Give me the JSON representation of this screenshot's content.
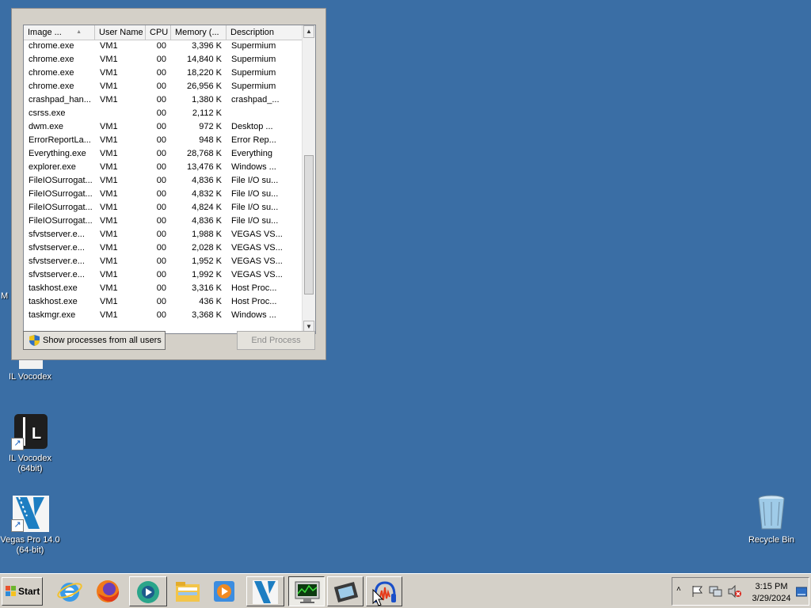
{
  "desktop": {
    "background": "#3a6ea5",
    "partial_label": "M",
    "icons": [
      {
        "label": "IL Vocodex",
        "icon": "il-vocodex-icon"
      },
      {
        "label": "IL Vocodex\n(64bit)",
        "icon": "il-vocodex-64-icon"
      },
      {
        "label": "Vegas Pro 14.0\n(64-bit)",
        "icon": "vegas-pro-icon"
      },
      {
        "label": "Recycle Bin",
        "icon": "recycle-bin-icon"
      }
    ]
  },
  "task_manager": {
    "columns": [
      "Image ...",
      "User Name",
      "CPU",
      "Memory (...",
      "Description"
    ],
    "sort_column": "Image ...",
    "rows": [
      {
        "image": "chrome.exe",
        "user": "VM1",
        "cpu": "00",
        "memory": "3,396 K",
        "desc": "Supermium"
      },
      {
        "image": "chrome.exe",
        "user": "VM1",
        "cpu": "00",
        "memory": "14,840 K",
        "desc": "Supermium"
      },
      {
        "image": "chrome.exe",
        "user": "VM1",
        "cpu": "00",
        "memory": "18,220 K",
        "desc": "Supermium"
      },
      {
        "image": "chrome.exe",
        "user": "VM1",
        "cpu": "00",
        "memory": "26,956 K",
        "desc": "Supermium"
      },
      {
        "image": "crashpad_han...",
        "user": "VM1",
        "cpu": "00",
        "memory": "1,380 K",
        "desc": "crashpad_..."
      },
      {
        "image": "csrss.exe",
        "user": "",
        "cpu": "00",
        "memory": "2,112 K",
        "desc": ""
      },
      {
        "image": "dwm.exe",
        "user": "VM1",
        "cpu": "00",
        "memory": "972 K",
        "desc": "Desktop ..."
      },
      {
        "image": "ErrorReportLa...",
        "user": "VM1",
        "cpu": "00",
        "memory": "948 K",
        "desc": "Error Rep..."
      },
      {
        "image": "Everything.exe",
        "user": "VM1",
        "cpu": "00",
        "memory": "28,768 K",
        "desc": "Everything"
      },
      {
        "image": "explorer.exe",
        "user": "VM1",
        "cpu": "00",
        "memory": "13,476 K",
        "desc": "Windows ..."
      },
      {
        "image": "FileIOSurrogat...",
        "user": "VM1",
        "cpu": "00",
        "memory": "4,836 K",
        "desc": "File I/O su..."
      },
      {
        "image": "FileIOSurrogat...",
        "user": "VM1",
        "cpu": "00",
        "memory": "4,832 K",
        "desc": "File I/O su..."
      },
      {
        "image": "FileIOSurrogat...",
        "user": "VM1",
        "cpu": "00",
        "memory": "4,824 K",
        "desc": "File I/O su..."
      },
      {
        "image": "FileIOSurrogat...",
        "user": "VM1",
        "cpu": "00",
        "memory": "4,836 K",
        "desc": "File I/O su..."
      },
      {
        "image": "sfvstserver.e...",
        "user": "VM1",
        "cpu": "00",
        "memory": "1,988 K",
        "desc": "VEGAS VS..."
      },
      {
        "image": "sfvstserver.e...",
        "user": "VM1",
        "cpu": "00",
        "memory": "2,028 K",
        "desc": "VEGAS VS..."
      },
      {
        "image": "sfvstserver.e...",
        "user": "VM1",
        "cpu": "00",
        "memory": "1,952 K",
        "desc": "VEGAS VS..."
      },
      {
        "image": "sfvstserver.e...",
        "user": "VM1",
        "cpu": "00",
        "memory": "1,992 K",
        "desc": "VEGAS VS..."
      },
      {
        "image": "taskhost.exe",
        "user": "VM1",
        "cpu": "00",
        "memory": "3,316 K",
        "desc": "Host Proc..."
      },
      {
        "image": "taskhost.exe",
        "user": "VM1",
        "cpu": "00",
        "memory": "436 K",
        "desc": "Host Proc..."
      },
      {
        "image": "taskmgr.exe",
        "user": "VM1",
        "cpu": "00",
        "memory": "3,368 K",
        "desc": "Windows ..."
      }
    ],
    "show_all_label": "Show processes from all users",
    "end_process_label": "End Process"
  },
  "taskbar": {
    "start_label": "Start",
    "quick_launch": [
      "internet-explorer-icon",
      "firefox-icon",
      "media-app-icon",
      "windows-explorer-icon",
      "media-player-icon",
      "vegas-pro-icon"
    ],
    "tasks": [
      "task-manager-icon",
      "video-editor-icon",
      "audio-editor-icon"
    ],
    "tray_icons": [
      "show-hidden-icons-chevron",
      "action-center-flag-icon",
      "network-icon",
      "volume-muted-icon",
      "show-desktop-button"
    ],
    "time": "3:15 PM",
    "date": "3/29/2024"
  }
}
